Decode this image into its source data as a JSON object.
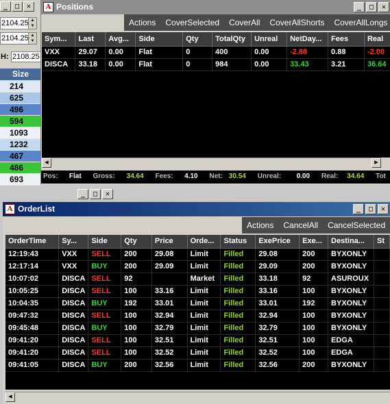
{
  "left_window": {
    "spin_top": "2104.25",
    "spin_bottom": "2104.25",
    "h_label": "H:",
    "h_value": "2108.25",
    "size_header": "Size",
    "sizes": [
      "214",
      "625",
      "496",
      "594",
      "1093",
      "1232",
      "467",
      "486",
      "693"
    ]
  },
  "positions": {
    "title": "Positions",
    "menu": [
      "Actions",
      "CoverSelected",
      "CoverAll",
      "CoverAllShorts",
      "CoverAllLongs"
    ],
    "columns": [
      "Sym...",
      "Last",
      "Avg...",
      "Side",
      "Qty",
      "TotalQty",
      "Unreal",
      "NetDay...",
      "Fees",
      "Real"
    ],
    "rows": [
      {
        "sym": "VXX",
        "last": "29.07",
        "avg": "0.00",
        "side": "Flat",
        "qty": "0",
        "totalqty": "400",
        "unreal": "0.00",
        "netday": "-2.88",
        "fees": "0.88",
        "real": "-2.00"
      },
      {
        "sym": "DISCA",
        "last": "33.18",
        "avg": "0.00",
        "side": "Flat",
        "qty": "0",
        "totalqty": "984",
        "unreal": "0.00",
        "netday": "33.43",
        "fees": "3.21",
        "real": "36.64"
      }
    ],
    "status": {
      "pos_label": "Pos:",
      "pos_value": "Flat",
      "gross_label": "Gross:",
      "gross_value": "34.64",
      "fees_label": "Fees:",
      "fees_value": "4.10",
      "net_label": "Net:",
      "net_value": "30.54",
      "unreal_label": "Unreal:",
      "unreal_value": "0.00",
      "real_label": "Real:",
      "real_value": "34.64",
      "tot_label": "Tot"
    }
  },
  "orderlist": {
    "title": "OrderList",
    "menu": [
      "Actions",
      "CancelAll",
      "CancelSelected"
    ],
    "columns": [
      "OrderTime",
      "Sy...",
      "Side",
      "Qty",
      "Price",
      "Orde...",
      "Status",
      "ExePrice",
      "Exe...",
      "Destina...",
      "St"
    ],
    "rows": [
      {
        "time": "12:19:43",
        "sym": "VXX",
        "side": "SELL",
        "qty": "200",
        "price": "29.08",
        "type": "Limit",
        "status": "Filled",
        "exeprice": "29.08",
        "exeqty": "200",
        "dest": "BYXONLY"
      },
      {
        "time": "12:17:14",
        "sym": "VXX",
        "side": "BUY",
        "qty": "200",
        "price": "29.09",
        "type": "Limit",
        "status": "Filled",
        "exeprice": "29.09",
        "exeqty": "200",
        "dest": "BYXONLY"
      },
      {
        "time": "10:07:02",
        "sym": "DISCA",
        "side": "SELL",
        "qty": "92",
        "price": "",
        "type": "Market",
        "status": "Filled",
        "exeprice": "33.18",
        "exeqty": "92",
        "dest": "ASUROUX"
      },
      {
        "time": "10:05:25",
        "sym": "DISCA",
        "side": "SELL",
        "qty": "100",
        "price": "33.16",
        "type": "Limit",
        "status": "Filled",
        "exeprice": "33.16",
        "exeqty": "100",
        "dest": "BYXONLY"
      },
      {
        "time": "10:04:35",
        "sym": "DISCA",
        "side": "BUY",
        "qty": "192",
        "price": "33.01",
        "type": "Limit",
        "status": "Filled",
        "exeprice": "33.01",
        "exeqty": "192",
        "dest": "BYXONLY"
      },
      {
        "time": "09:47:32",
        "sym": "DISCA",
        "side": "SELL",
        "qty": "100",
        "price": "32.94",
        "type": "Limit",
        "status": "Filled",
        "exeprice": "32.94",
        "exeqty": "100",
        "dest": "BYXONLY"
      },
      {
        "time": "09:45:48",
        "sym": "DISCA",
        "side": "BUY",
        "qty": "100",
        "price": "32.79",
        "type": "Limit",
        "status": "Filled",
        "exeprice": "32.79",
        "exeqty": "100",
        "dest": "BYXONLY"
      },
      {
        "time": "09:41:20",
        "sym": "DISCA",
        "side": "SELL",
        "qty": "100",
        "price": "32.51",
        "type": "Limit",
        "status": "Filled",
        "exeprice": "32.51",
        "exeqty": "100",
        "dest": "EDGA"
      },
      {
        "time": "09:41:20",
        "sym": "DISCA",
        "side": "SELL",
        "qty": "100",
        "price": "32.52",
        "type": "Limit",
        "status": "Filled",
        "exeprice": "32.52",
        "exeqty": "100",
        "dest": "EDGA"
      },
      {
        "time": "09:41:05",
        "sym": "DISCA",
        "side": "BUY",
        "qty": "200",
        "price": "32.56",
        "type": "Limit",
        "status": "Filled",
        "exeprice": "32.56",
        "exeqty": "200",
        "dest": "BYXONLY"
      }
    ]
  },
  "window_controls": {
    "minimize": "_",
    "maximize": "□",
    "close": "✕"
  },
  "app_icon_letter": "A",
  "colors": {
    "sell": "#ff3a2a",
    "buy": "#38d43a",
    "filled": "#8fd628",
    "negative": "#ff3a2a",
    "positive": "#38d43a",
    "status_value": "#b8d84a"
  },
  "size_colors": [
    "#dfe8f4",
    "#a8c6e8",
    "#5a86c8",
    "#3cc43c",
    "#eef2f8",
    "#c4d8ee",
    "#5a86c8",
    "#3cc43c",
    "#eef2f8"
  ]
}
